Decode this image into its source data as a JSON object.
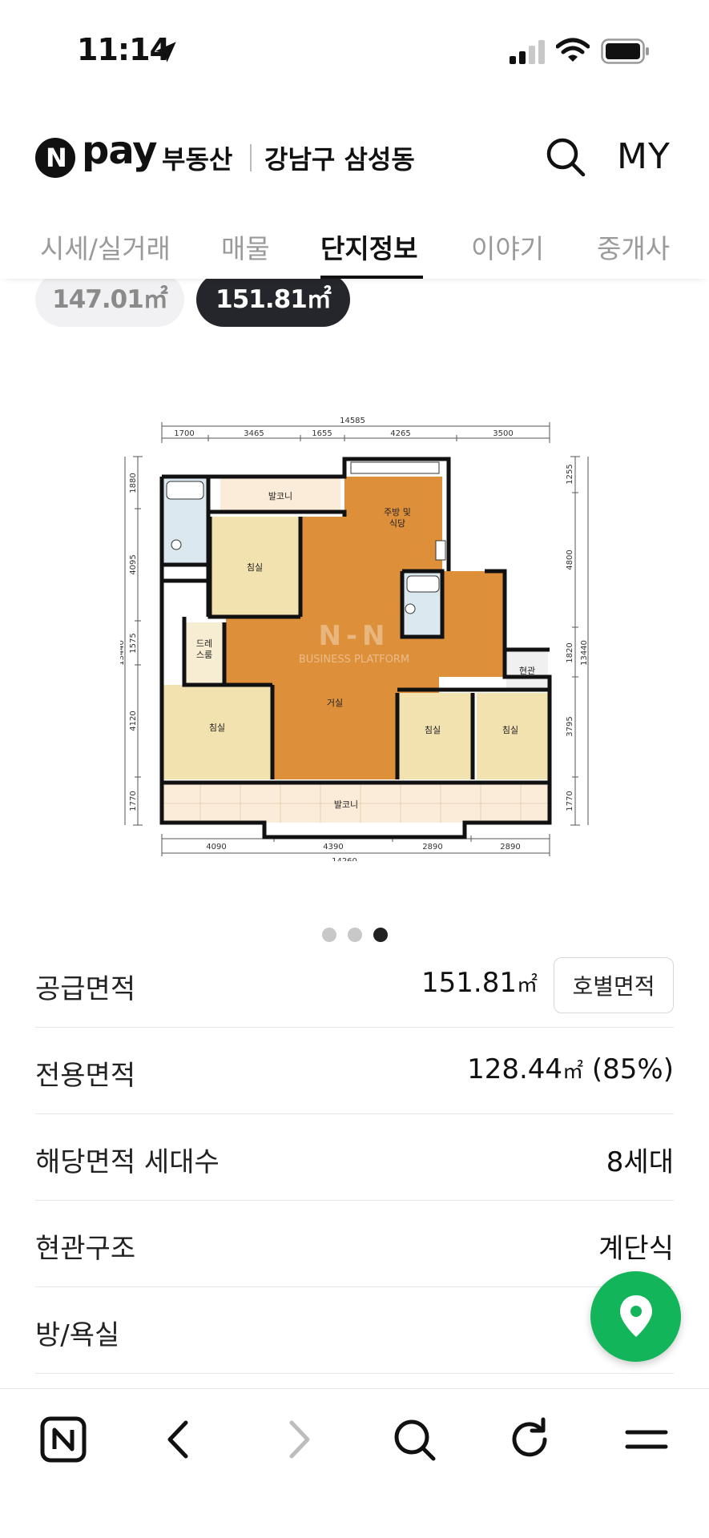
{
  "status_bar": {
    "time": "11:14"
  },
  "header": {
    "brand_n": "N",
    "brand_pay": "pay",
    "brand_service": "부동산",
    "region": "강남구 삼성동",
    "my_label": "MY"
  },
  "tabs": [
    {
      "label": "시세/실거래"
    },
    {
      "label": "매물"
    },
    {
      "label": "단지정보"
    },
    {
      "label": "이야기"
    },
    {
      "label": "중개사"
    }
  ],
  "area_chips": [
    {
      "label": "147.01㎡",
      "selected": false
    },
    {
      "label": "151.81㎡",
      "selected": true
    }
  ],
  "floorplan": {
    "top_total": "14585",
    "top_dims": [
      "1700",
      "3465",
      "1655",
      "4265",
      "3500"
    ],
    "bottom_dims": [
      "4090",
      "4390",
      "2890",
      "2890"
    ],
    "bottom_total": "14260",
    "left_dims": [
      "1880",
      "4095",
      "1575",
      "4120",
      "1770"
    ],
    "left_total": "13440",
    "right_dims": [
      "1255",
      "4800",
      "1820",
      "3795",
      "1770"
    ],
    "right_total": "13440",
    "rooms": {
      "balcony_top": "발코니",
      "kitchen_line1": "주방 및",
      "kitchen_line2": "식당",
      "bedroom": "침실",
      "dressroom_line1": "드레",
      "dressroom_line2": "스룸",
      "entrance": "현관",
      "living": "거실",
      "balcony_bottom": "발코니"
    },
    "watermark_logo": "N-N",
    "watermark_text": "BUSINESS PLATFORM"
  },
  "pager": {
    "count": 3,
    "active": 2
  },
  "info": {
    "supply_label": "공급면적",
    "supply_value": "151.81",
    "supply_unit": "㎡",
    "supply_button": "호별면적",
    "exclusive_label": "전용면적",
    "exclusive_value": "128.44",
    "exclusive_unit": "㎡",
    "exclusive_ratio": "(85%)",
    "households_label": "해당면적 세대수",
    "households_value": "8세대",
    "entrance_label": "현관구조",
    "entrance_value": "계단식",
    "rooms_label": "방/욕실"
  },
  "colors": {
    "fab": "#12b55a",
    "floor_orange": "#dd8f3a",
    "room_cream": "#f3e4b4",
    "tab_active": "#111111",
    "chip_active": "#24262b"
  }
}
